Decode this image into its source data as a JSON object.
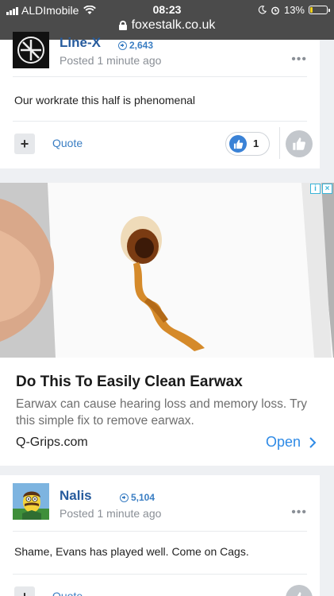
{
  "status_bar": {
    "carrier": "ALDImobile",
    "time": "08:23",
    "battery": "13%",
    "battery_level": 0.13,
    "url": "foxestalk.co.uk"
  },
  "posts": [
    {
      "author": "Line-X",
      "reputation": "2,643",
      "posted": "Posted 1 minute ago",
      "text": "Our workrate this half is phenomenal",
      "quote_label": "Quote",
      "likes": "1"
    },
    {
      "author": "Nalis",
      "reputation": "5,104",
      "posted": "Posted 1 minute ago",
      "text": "Shame, Evans has played well. Come on Cags.",
      "quote_label": "Quote"
    }
  ],
  "ad": {
    "title": "Do This To Easily Clean Earwax",
    "description": "Earwax can cause hearing loss and memory loss. Try this simple fix to remove earwax.",
    "source": "Q-Grips.com",
    "cta": "Open"
  },
  "colors": {
    "link_blue": "#3a7ec3",
    "author_blue": "#265b9d",
    "like_blue": "#3a82d6",
    "status_bar_bg": "#4b4b4b"
  }
}
